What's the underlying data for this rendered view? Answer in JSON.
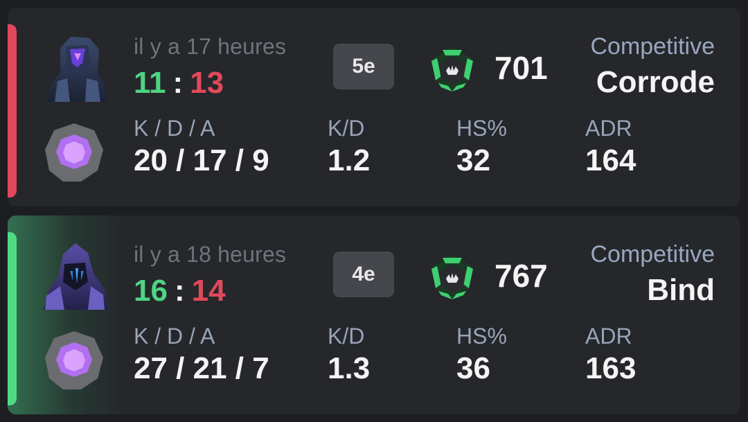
{
  "matches": [
    {
      "result": "loss",
      "accent_color": "#e0485b",
      "agent_icon": "agent-portrait-icon",
      "rank_icon": "amethyst-rank-icon",
      "time_ago": "il y a 17 heures",
      "score_won": "11",
      "score_separator": ":",
      "score_lost": "13",
      "placement": "5e",
      "rr_icon": "competitive-rank-emblem-icon",
      "rating": "701",
      "mode": "Competitive",
      "map": "Corrode",
      "stats": {
        "kda_label": "K / D / A",
        "kda": "20 / 17 / 9",
        "kd_label": "K/D",
        "kd": "1.2",
        "hs_label": "HS%",
        "hs": "32",
        "adr_label": "ADR",
        "adr": "164"
      }
    },
    {
      "result": "win",
      "accent_color": "#4fdb84",
      "agent_icon": "agent-portrait-icon",
      "rank_icon": "amethyst-rank-icon",
      "time_ago": "il y a 18 heures",
      "score_won": "16",
      "score_separator": ":",
      "score_lost": "14",
      "placement": "4e",
      "rr_icon": "competitive-rank-emblem-icon",
      "rating": "767",
      "mode": "Competitive",
      "map": "Bind",
      "stats": {
        "kda_label": "K / D / A",
        "kda": "27 / 21 / 7",
        "kd_label": "K/D",
        "kd": "1.3",
        "hs_label": "HS%",
        "hs": "36",
        "adr_label": "ADR",
        "adr": "163"
      }
    }
  ]
}
